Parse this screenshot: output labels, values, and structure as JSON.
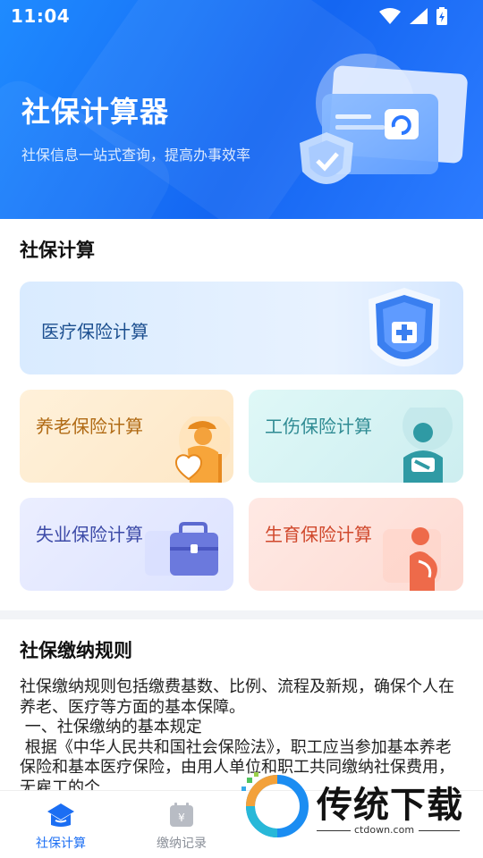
{
  "status_bar": {
    "time": "11:04"
  },
  "hero": {
    "title": "社保计算器",
    "subtitle": "社保信息一站式查询，提高办事效率"
  },
  "calc_section": {
    "title": "社保计算",
    "cards": [
      {
        "label": "医疗保险计算",
        "icon": "medical-shield-icon"
      },
      {
        "label": "养老保险计算",
        "icon": "elderly-person-icon"
      },
      {
        "label": "工伤保险计算",
        "icon": "injured-person-icon"
      },
      {
        "label": "失业保险计算",
        "icon": "briefcase-icon"
      },
      {
        "label": "生育保险计算",
        "icon": "pregnant-woman-icon"
      }
    ]
  },
  "rules_section": {
    "title": "社保缴纳规则",
    "body": "社保缴纳规则包括缴费基数、比例、流程及新规，确保个人在养老、医疗等方面的基本保障。\n 一、社保缴纳的基本规定\n 根据《中华人民共和国社会保险法》，职工应当参加基本养老保险和基本医疗保险，由用人单位和职工共同缴纳社保费用，无雇工的个"
  },
  "bottom_nav": {
    "items": [
      {
        "label": "社保计算",
        "icon": "home-hat-icon",
        "active": true
      },
      {
        "label": "缴纳记录",
        "icon": "calendar-yen-icon",
        "active": false
      }
    ]
  },
  "watermark": {
    "text": "传统下载",
    "url": "ctdown.com"
  },
  "colors": {
    "primary": "#1B6EF3",
    "hero_start": "#1F8BFF",
    "hero_end": "#1466F2",
    "nav_inactive": "#8A8F98"
  }
}
